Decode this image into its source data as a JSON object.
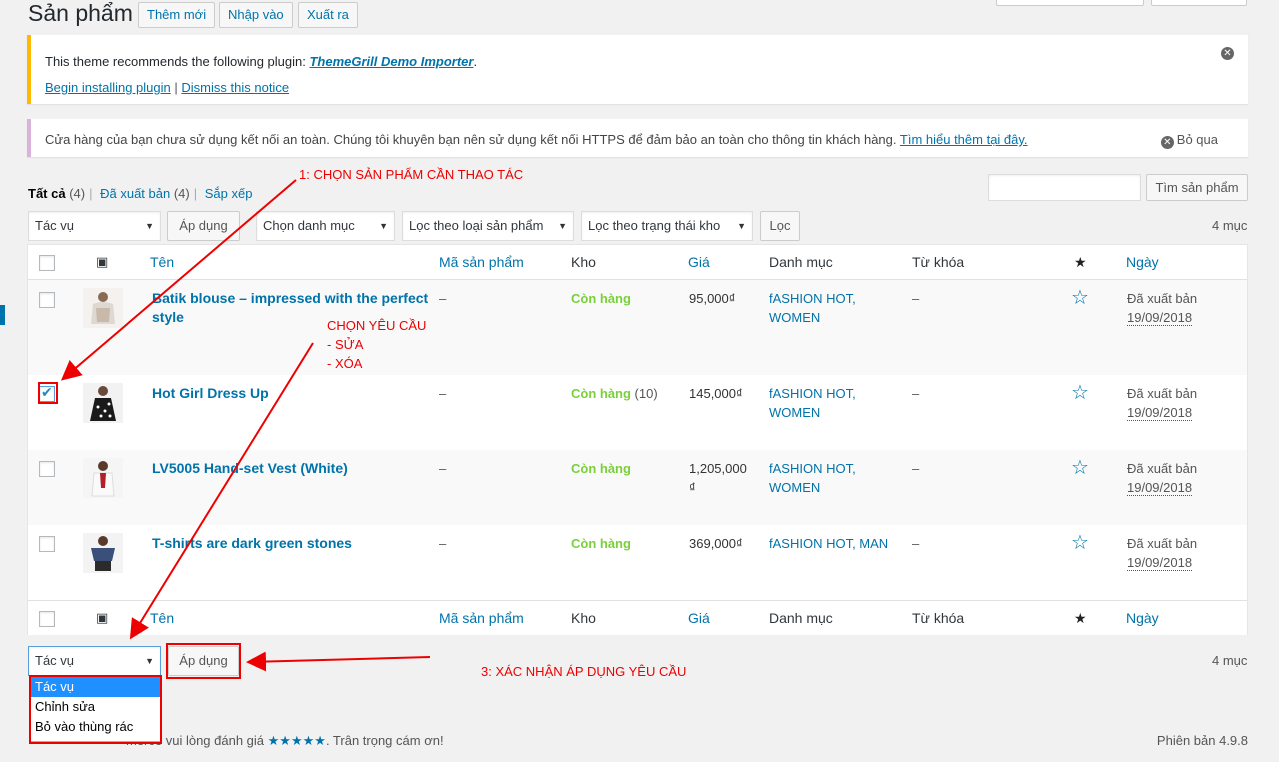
{
  "header": {
    "title": "Sản phẩm",
    "buttons": [
      "Thêm mới",
      "Nhập vào",
      "Xuất ra"
    ]
  },
  "notice_plugin": {
    "text": "This theme recommends the following plugin: ",
    "plugin_name": "ThemeGrill Demo Importer",
    "period": ".",
    "begin_link": "Begin installing plugin",
    "separator": "|",
    "dismiss_link": "Dismiss this notice"
  },
  "notice_https": {
    "text": "Cửa hàng của bạn chưa sử dụng kết nối an toàn. Chúng tôi khuyên bạn nên sử dụng kết nối HTTPS để đảm bảo an toàn cho thông tin khách hàng. ",
    "link": "Tìm hiểu thêm tại đây.",
    "dismiss": "Bỏ qua"
  },
  "views": {
    "all_label": "Tất cả",
    "all_count": "(4)",
    "published_label": "Đã xuất bản",
    "published_count": "(4)",
    "sort_label": "Sắp xếp"
  },
  "search": {
    "value": "",
    "button": "Tìm sản phẩm"
  },
  "filters": {
    "bulk_action": "Tác vụ",
    "apply": "Áp dụng",
    "category": "Chọn danh mục",
    "product_type": "Lọc theo loại sản phẩm",
    "stock_status": "Lọc theo trạng thái kho",
    "filter_button": "Lọc",
    "count": "4 mục"
  },
  "columns": {
    "name": "Tên",
    "sku": "Mã sản phẩm",
    "stock": "Kho",
    "price": "Giá",
    "categories": "Danh mục",
    "tags": "Từ khóa",
    "featured": "★",
    "date": "Ngày"
  },
  "products": [
    {
      "name_line1": "Batik blouse – impressed with the perfect",
      "name_line2": "style",
      "sku": "–",
      "stock": "Còn hàng",
      "stock_qty": "",
      "price_line1": "95,000₫",
      "price_line2": "",
      "cat_line1": "fASHION HOT,",
      "cat_line2": "WOMEN",
      "tags": "–",
      "status": "Đã xuất bản",
      "date": "19/09/2018",
      "checked": false
    },
    {
      "name_line1": "Hot Girl Dress Up",
      "name_line2": "",
      "sku": "–",
      "stock": "Còn hàng",
      "stock_qty": " (10)",
      "price_line1": "145,000₫",
      "price_line2": "",
      "cat_line1": "fASHION HOT,",
      "cat_line2": "WOMEN",
      "tags": "–",
      "status": "Đã xuất bản",
      "date": "19/09/2018",
      "checked": true
    },
    {
      "name_line1": "LV5005 Hand-set Vest (White)",
      "name_line2": "",
      "sku": "–",
      "stock": "Còn hàng",
      "stock_qty": "",
      "price_line1": "1,205,000",
      "price_line2": "₫",
      "cat_line1": "fASHION HOT,",
      "cat_line2": "WOMEN",
      "tags": "–",
      "status": "Đã xuất bản",
      "date": "19/09/2018",
      "checked": false
    },
    {
      "name_line1": "T-shirts are dark green stones",
      "name_line2": "",
      "sku": "–",
      "stock": "Còn hàng",
      "stock_qty": "",
      "price_line1": "369,000₫",
      "price_line2": "",
      "cat_line1": "fASHION HOT, MAN",
      "cat_line2": "",
      "tags": "–",
      "status": "Đã xuất bản",
      "date": "19/09/2018",
      "checked": false
    }
  ],
  "bottom_bar": {
    "bulk_action": "Tác vụ",
    "apply": "Áp dụng",
    "count": "4 mục",
    "options": [
      "Tác vụ",
      "Chỉnh sửa",
      "Bỏ vào thùng rác"
    ]
  },
  "footer": {
    "left_text": "merce vui lòng đánh giá ",
    "stars": "★★★★★",
    "left_tail": ". Trân trọng cám ơn!",
    "version": "Phiên bản 4.9.8"
  },
  "annotations": {
    "step1": "1: CHỌN SẢN PHẨM CẦN THAO TÁC",
    "step2_title": "CHỌN YÊU CẦU",
    "step2_edit": "- SỬA",
    "step2_delete": "- XÓA",
    "step3": "3: XÁC  NHẬN ÁP DỤNG YÊU CẦU",
    "color": "#e00000"
  }
}
